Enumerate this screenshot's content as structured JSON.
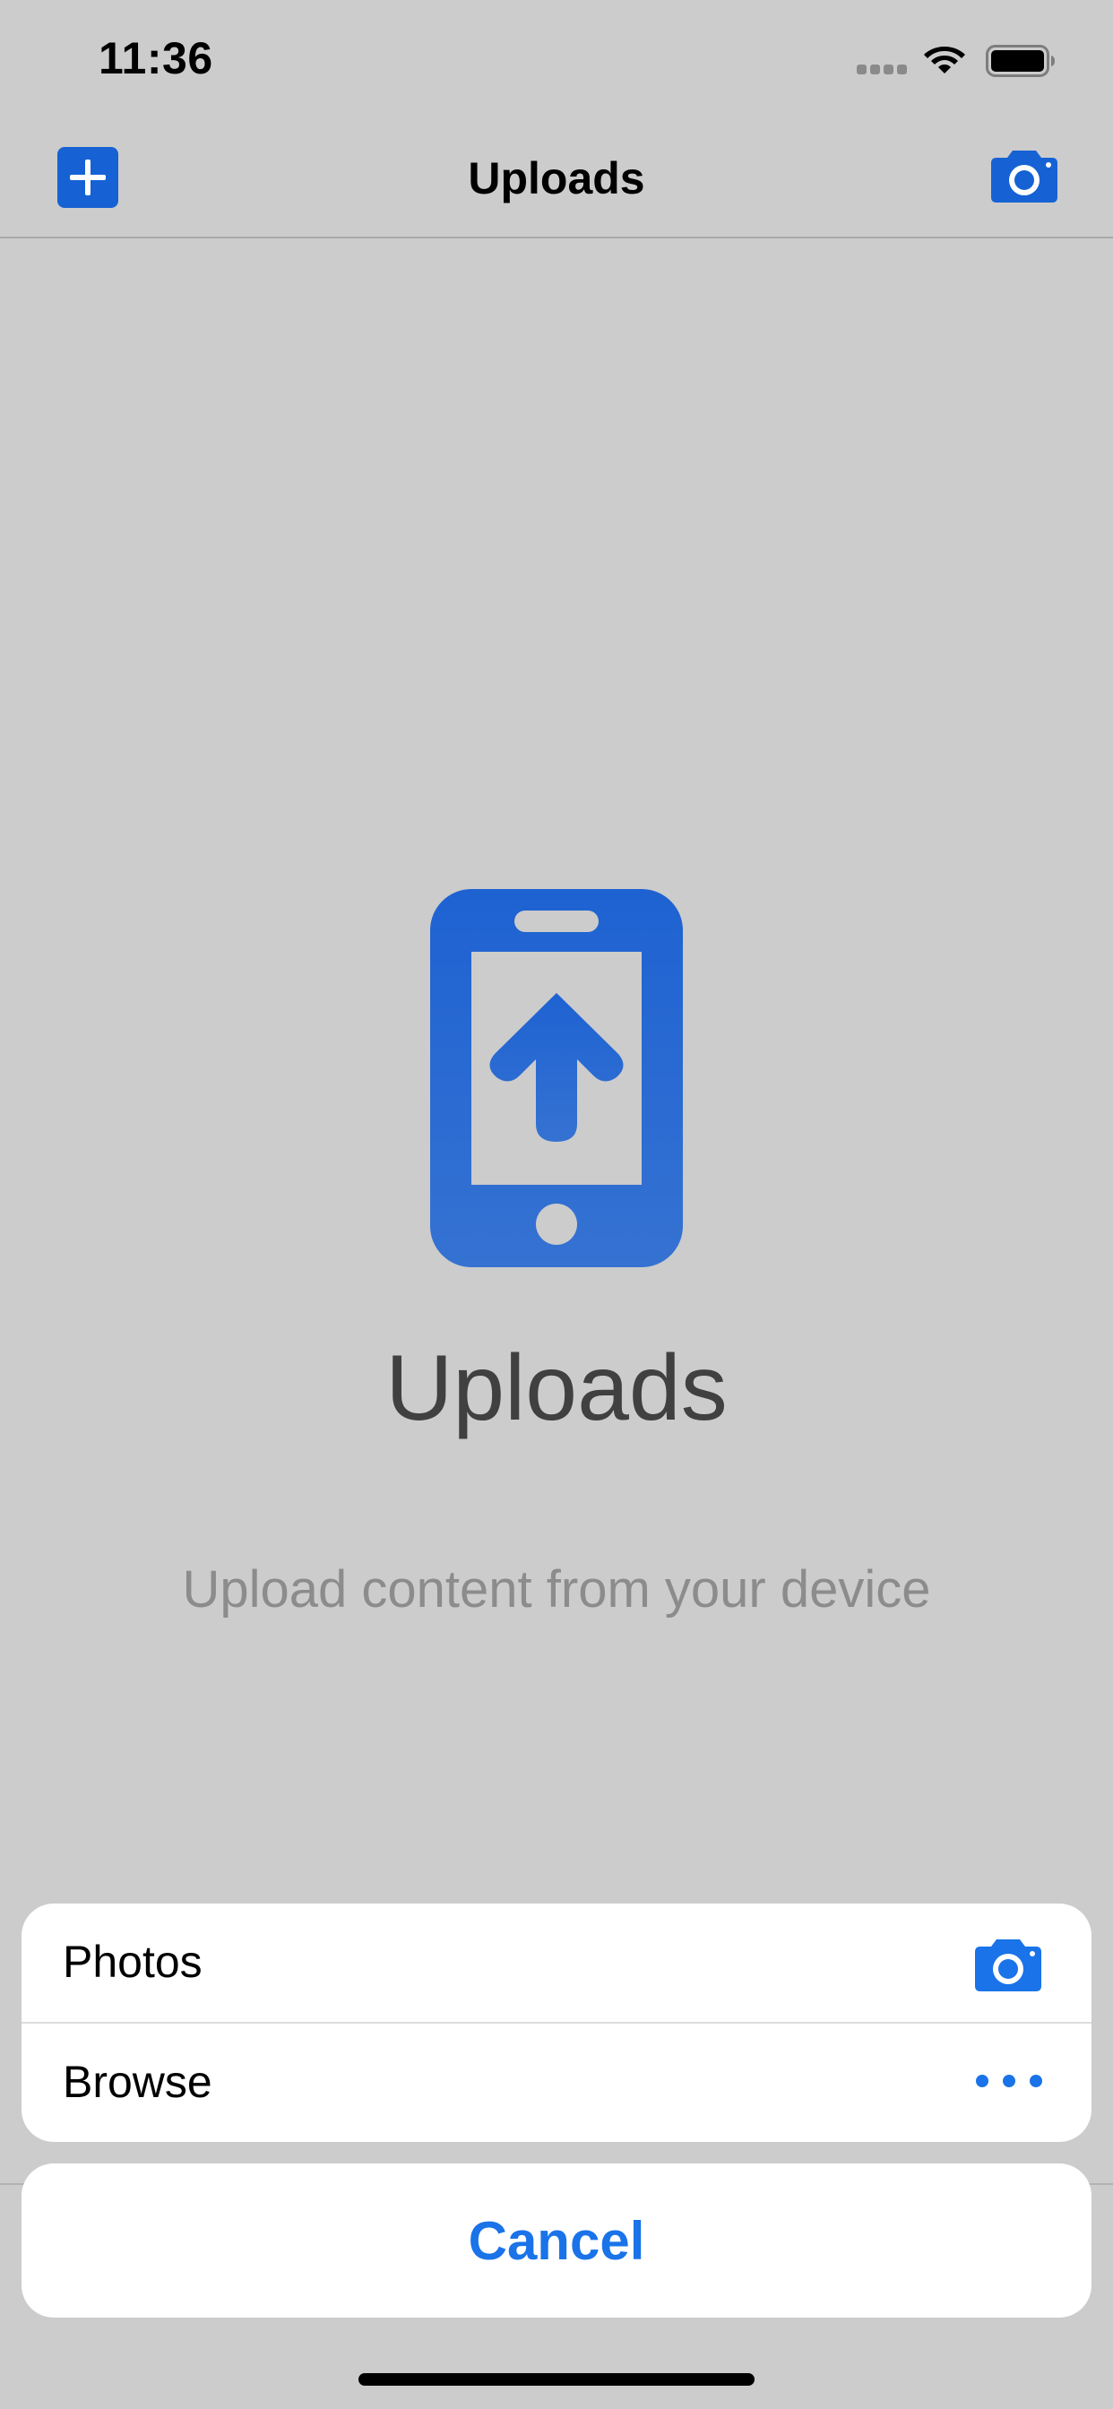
{
  "status_bar": {
    "time": "11:36",
    "signal_icon": "signal-icon",
    "wifi_icon": "wifi-icon",
    "battery_icon": "battery-icon"
  },
  "nav_bar": {
    "title": "Uploads",
    "left_icon": "plus-icon",
    "right_icon": "camera-icon"
  },
  "empty_state": {
    "icon": "phone-upload-icon",
    "title": "Uploads",
    "subtitle": "Upload content from your device"
  },
  "action_sheet": {
    "options": [
      {
        "label": "Photos",
        "icon": "camera-icon"
      },
      {
        "label": "Browse",
        "icon": "more-icon"
      }
    ],
    "cancel_label": "Cancel"
  },
  "colors": {
    "accent": "#1662d4",
    "link": "#1a73e8",
    "dim_background": "#cccccc",
    "sheet_background": "#ffffff"
  }
}
